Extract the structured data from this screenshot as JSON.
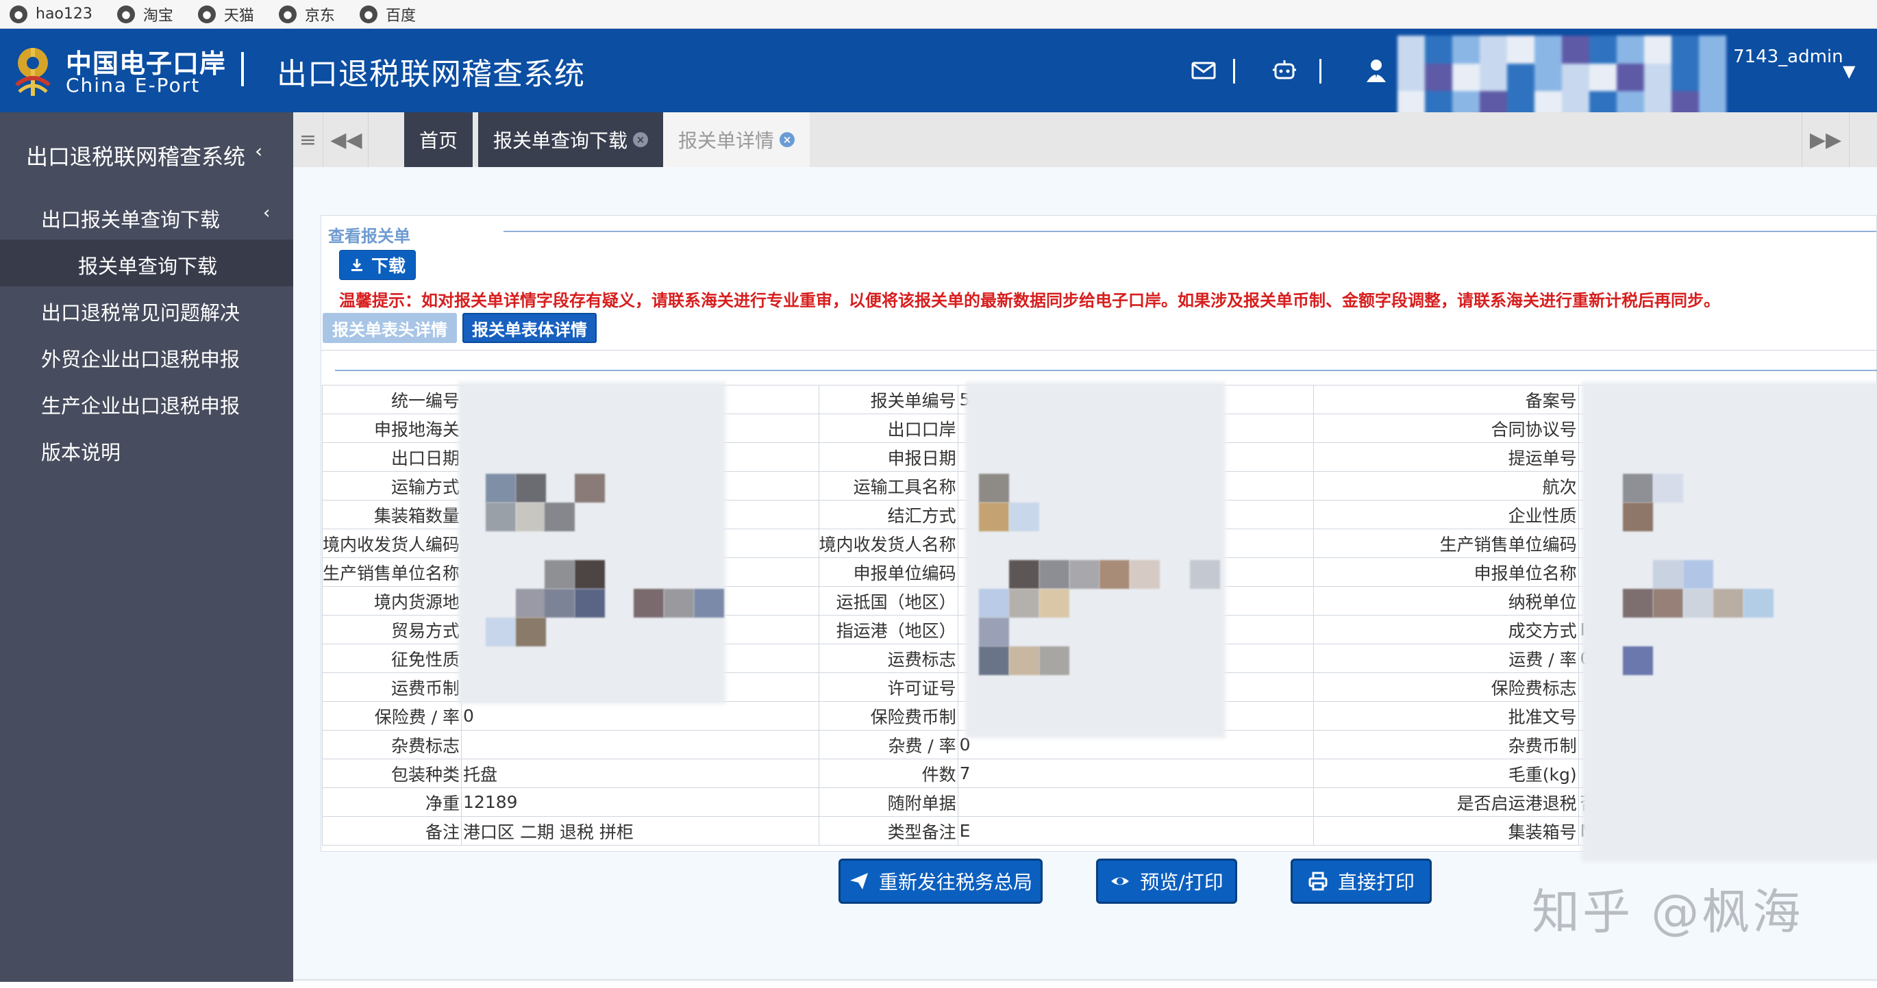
{
  "bookmarks": [
    "hao123",
    "淘宝",
    "天猫",
    "京东",
    "百度"
  ],
  "header": {
    "logo_cn": "中国电子口岸",
    "logo_en": "China E-Port",
    "system_title": "出口退税联网稽查系统",
    "user_name": "7143_admin"
  },
  "sidebar": {
    "title": "出口退税联网稽查系统",
    "items": [
      {
        "label": "出口报关单查询下载",
        "sub": "报关单查询下载"
      },
      {
        "label": "出口退税常见问题解决"
      },
      {
        "label": "外贸企业出口退税申报"
      },
      {
        "label": "生产企业出口退税申报"
      },
      {
        "label": "版本说明"
      }
    ]
  },
  "tabs": {
    "home": "首页",
    "query": "报关单查询下载",
    "detail": "报关单详情"
  },
  "panel": {
    "title": "查看报关单",
    "download": "下载",
    "warning": "温馨提示：如对报关单详情字段存有疑义，请联系海关进行专业重审，以便将该报关单的最新数据同步给电子口岸。如果涉及报关单币制、金额字段调整，请联系海关进行重新计税后再同步。",
    "subtab_head": "报关单表头详情",
    "subtab_body": "报关单表体详情"
  },
  "form_rows": [
    [
      "统一编号",
      "",
      "报关单编号",
      "5",
      "备案号",
      ""
    ],
    [
      "申报地海关",
      "",
      "出口口岸",
      "",
      "合同协议号",
      ""
    ],
    [
      "出口日期",
      "",
      "申报日期",
      "",
      "提运单号",
      ""
    ],
    [
      "运输方式",
      "",
      "运输工具名称",
      "",
      "航次",
      ""
    ],
    [
      "集装箱数量",
      "",
      "结汇方式",
      "",
      "企业性质",
      ""
    ],
    [
      "境内收发货人编码",
      "",
      "境内收发货人名称",
      "",
      "生产销售单位编码",
      ""
    ],
    [
      "生产销售单位名称",
      "",
      "申报单位编码",
      "",
      "申报单位名称",
      ""
    ],
    [
      "境内货源地",
      "",
      "运抵国（地区）",
      "",
      "纳税单位",
      ""
    ],
    [
      "贸易方式",
      "",
      "指运港（地区）",
      "",
      "成交方式",
      "I"
    ],
    [
      "征免性质",
      "",
      "运费标志",
      "",
      "运费 / 率",
      "0"
    ],
    [
      "运费币制",
      "",
      "许可证号",
      "",
      "保险费标志",
      ""
    ],
    [
      "保险费 / 率",
      "0",
      "保险费币制",
      "",
      "批准文号",
      ""
    ],
    [
      "杂费标志",
      "",
      "杂费 / 率",
      "0",
      "杂费币制",
      ""
    ],
    [
      "包装种类",
      "托盘",
      "件数",
      "7",
      "毛重(kg)",
      ""
    ],
    [
      "净重",
      "12189",
      "随附单据",
      "",
      "是否启运港退税",
      "否"
    ],
    [
      "备注",
      "港口区 二期 退税 拼柜",
      "类型备注",
      "E",
      "集装箱号",
      "M"
    ]
  ],
  "actions": {
    "resend": "重新发往税务总局",
    "preview": "预览/打印",
    "print": "直接打印"
  },
  "watermark": "知乎 @枫海",
  "colors": {
    "header_bg": "#0b4ea2",
    "sidebar_bg": "#474c5e",
    "primary_button": "#0b5fbf",
    "warning_text": "#d71e1e"
  }
}
